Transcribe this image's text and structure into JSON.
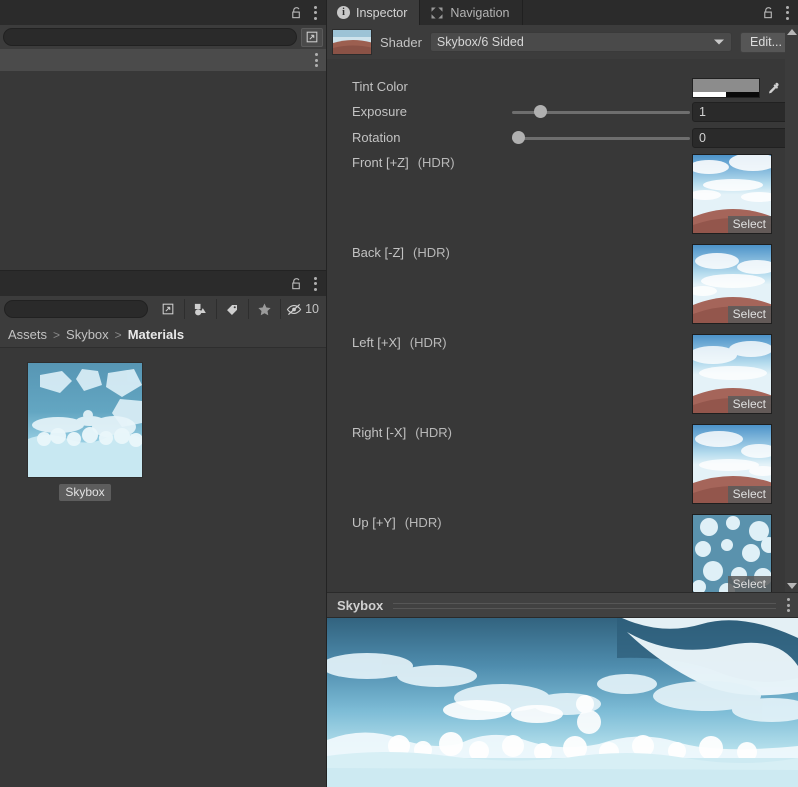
{
  "left_top_panel": {
    "search_placeholder": "",
    "search_value": "",
    "subasset_toggle_icon": "subasset-toggle-icon",
    "lock_icon": "lock-icon",
    "menu_icon": "kebab-menu-icon"
  },
  "project_browser": {
    "lock_icon": "lock-icon",
    "menu_icon": "kebab-menu-icon",
    "filters": [
      {
        "name": "subasset-toggle",
        "icon": "subasset-toggle-icon",
        "label": ""
      },
      {
        "name": "type-filter",
        "icon": "shapes-icon",
        "label": ""
      },
      {
        "name": "label-filter",
        "icon": "tag-icon",
        "label": ""
      },
      {
        "name": "favorites-filter",
        "icon": "star-icon",
        "label": ""
      },
      {
        "name": "hidden-count",
        "icon": "eye-off-icon",
        "label": "10"
      }
    ],
    "breadcrumb": [
      {
        "label": "Assets",
        "current": false
      },
      {
        "label": "Skybox",
        "current": false
      },
      {
        "label": "Materials",
        "current": true
      }
    ],
    "breadcrumb_separator": ">",
    "assets": [
      {
        "name": "Skybox",
        "selected": true
      }
    ]
  },
  "inspector": {
    "tabs": [
      {
        "label": "Inspector",
        "icon": "info-icon",
        "active": true
      },
      {
        "label": "Navigation",
        "icon": "navigation-icon",
        "active": false
      }
    ],
    "lock_icon": "lock-icon",
    "menu_icon": "kebab-menu-icon",
    "shader_label": "Shader",
    "shader_value": "Skybox/6 Sided",
    "edit_button": "Edit...",
    "material_icon": "material-preview-icon",
    "properties": {
      "tint_color": {
        "label": "Tint Color",
        "color": "#8c8c8c",
        "eyedropper_icon": "eyedropper-icon"
      },
      "exposure": {
        "label": "Exposure",
        "value": "1",
        "slider_percent": 15
      },
      "rotation": {
        "label": "Rotation",
        "value": "0",
        "slider_percent": 2
      }
    },
    "texture_slots": [
      {
        "label": "Front [+Z]",
        "hdr": "(HDR)",
        "select_label": "Select",
        "face": "side"
      },
      {
        "label": "Back [-Z]",
        "hdr": "(HDR)",
        "select_label": "Select",
        "face": "side"
      },
      {
        "label": "Left [+X]",
        "hdr": "(HDR)",
        "select_label": "Select",
        "face": "side"
      },
      {
        "label": "Right [-X]",
        "hdr": "(HDR)",
        "select_label": "Select",
        "face": "side"
      },
      {
        "label": "Up [+Y]",
        "hdr": "(HDR)",
        "select_label": "Select",
        "face": "up"
      }
    ]
  },
  "preview": {
    "title": "Skybox",
    "menu_icon": "kebab-menu-icon"
  },
  "colors": {
    "panel_bg": "#383838",
    "tabbar_bg": "#2b2b2b",
    "toolbar_bg": "#3c3c3c",
    "text": "#c2c2c2",
    "sky_deep": "#3a6f8f",
    "sky_light": "#cdeaf2",
    "ground": "#9c5f50"
  }
}
